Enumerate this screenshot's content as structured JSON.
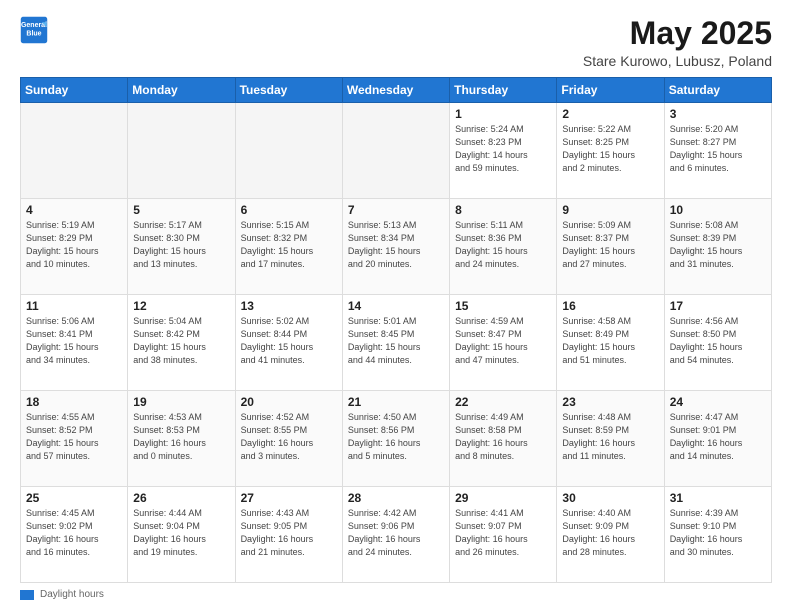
{
  "header": {
    "logo_line1": "General",
    "logo_line2": "Blue",
    "title": "May 2025",
    "subtitle": "Stare Kurowo, Lubusz, Poland"
  },
  "weekdays": [
    "Sunday",
    "Monday",
    "Tuesday",
    "Wednesday",
    "Thursday",
    "Friday",
    "Saturday"
  ],
  "weeks": [
    [
      {
        "day": "",
        "info": ""
      },
      {
        "day": "",
        "info": ""
      },
      {
        "day": "",
        "info": ""
      },
      {
        "day": "",
        "info": ""
      },
      {
        "day": "1",
        "info": "Sunrise: 5:24 AM\nSunset: 8:23 PM\nDaylight: 14 hours\nand 59 minutes."
      },
      {
        "day": "2",
        "info": "Sunrise: 5:22 AM\nSunset: 8:25 PM\nDaylight: 15 hours\nand 2 minutes."
      },
      {
        "day": "3",
        "info": "Sunrise: 5:20 AM\nSunset: 8:27 PM\nDaylight: 15 hours\nand 6 minutes."
      }
    ],
    [
      {
        "day": "4",
        "info": "Sunrise: 5:19 AM\nSunset: 8:29 PM\nDaylight: 15 hours\nand 10 minutes."
      },
      {
        "day": "5",
        "info": "Sunrise: 5:17 AM\nSunset: 8:30 PM\nDaylight: 15 hours\nand 13 minutes."
      },
      {
        "day": "6",
        "info": "Sunrise: 5:15 AM\nSunset: 8:32 PM\nDaylight: 15 hours\nand 17 minutes."
      },
      {
        "day": "7",
        "info": "Sunrise: 5:13 AM\nSunset: 8:34 PM\nDaylight: 15 hours\nand 20 minutes."
      },
      {
        "day": "8",
        "info": "Sunrise: 5:11 AM\nSunset: 8:36 PM\nDaylight: 15 hours\nand 24 minutes."
      },
      {
        "day": "9",
        "info": "Sunrise: 5:09 AM\nSunset: 8:37 PM\nDaylight: 15 hours\nand 27 minutes."
      },
      {
        "day": "10",
        "info": "Sunrise: 5:08 AM\nSunset: 8:39 PM\nDaylight: 15 hours\nand 31 minutes."
      }
    ],
    [
      {
        "day": "11",
        "info": "Sunrise: 5:06 AM\nSunset: 8:41 PM\nDaylight: 15 hours\nand 34 minutes."
      },
      {
        "day": "12",
        "info": "Sunrise: 5:04 AM\nSunset: 8:42 PM\nDaylight: 15 hours\nand 38 minutes."
      },
      {
        "day": "13",
        "info": "Sunrise: 5:02 AM\nSunset: 8:44 PM\nDaylight: 15 hours\nand 41 minutes."
      },
      {
        "day": "14",
        "info": "Sunrise: 5:01 AM\nSunset: 8:45 PM\nDaylight: 15 hours\nand 44 minutes."
      },
      {
        "day": "15",
        "info": "Sunrise: 4:59 AM\nSunset: 8:47 PM\nDaylight: 15 hours\nand 47 minutes."
      },
      {
        "day": "16",
        "info": "Sunrise: 4:58 AM\nSunset: 8:49 PM\nDaylight: 15 hours\nand 51 minutes."
      },
      {
        "day": "17",
        "info": "Sunrise: 4:56 AM\nSunset: 8:50 PM\nDaylight: 15 hours\nand 54 minutes."
      }
    ],
    [
      {
        "day": "18",
        "info": "Sunrise: 4:55 AM\nSunset: 8:52 PM\nDaylight: 15 hours\nand 57 minutes."
      },
      {
        "day": "19",
        "info": "Sunrise: 4:53 AM\nSunset: 8:53 PM\nDaylight: 16 hours\nand 0 minutes."
      },
      {
        "day": "20",
        "info": "Sunrise: 4:52 AM\nSunset: 8:55 PM\nDaylight: 16 hours\nand 3 minutes."
      },
      {
        "day": "21",
        "info": "Sunrise: 4:50 AM\nSunset: 8:56 PM\nDaylight: 16 hours\nand 5 minutes."
      },
      {
        "day": "22",
        "info": "Sunrise: 4:49 AM\nSunset: 8:58 PM\nDaylight: 16 hours\nand 8 minutes."
      },
      {
        "day": "23",
        "info": "Sunrise: 4:48 AM\nSunset: 8:59 PM\nDaylight: 16 hours\nand 11 minutes."
      },
      {
        "day": "24",
        "info": "Sunrise: 4:47 AM\nSunset: 9:01 PM\nDaylight: 16 hours\nand 14 minutes."
      }
    ],
    [
      {
        "day": "25",
        "info": "Sunrise: 4:45 AM\nSunset: 9:02 PM\nDaylight: 16 hours\nand 16 minutes."
      },
      {
        "day": "26",
        "info": "Sunrise: 4:44 AM\nSunset: 9:04 PM\nDaylight: 16 hours\nand 19 minutes."
      },
      {
        "day": "27",
        "info": "Sunrise: 4:43 AM\nSunset: 9:05 PM\nDaylight: 16 hours\nand 21 minutes."
      },
      {
        "day": "28",
        "info": "Sunrise: 4:42 AM\nSunset: 9:06 PM\nDaylight: 16 hours\nand 24 minutes."
      },
      {
        "day": "29",
        "info": "Sunrise: 4:41 AM\nSunset: 9:07 PM\nDaylight: 16 hours\nand 26 minutes."
      },
      {
        "day": "30",
        "info": "Sunrise: 4:40 AM\nSunset: 9:09 PM\nDaylight: 16 hours\nand 28 minutes."
      },
      {
        "day": "31",
        "info": "Sunrise: 4:39 AM\nSunset: 9:10 PM\nDaylight: 16 hours\nand 30 minutes."
      }
    ]
  ],
  "footer": {
    "daylight_label": "Daylight hours"
  },
  "colors": {
    "header_bg": "#2176d2",
    "accent": "#2176d2"
  }
}
